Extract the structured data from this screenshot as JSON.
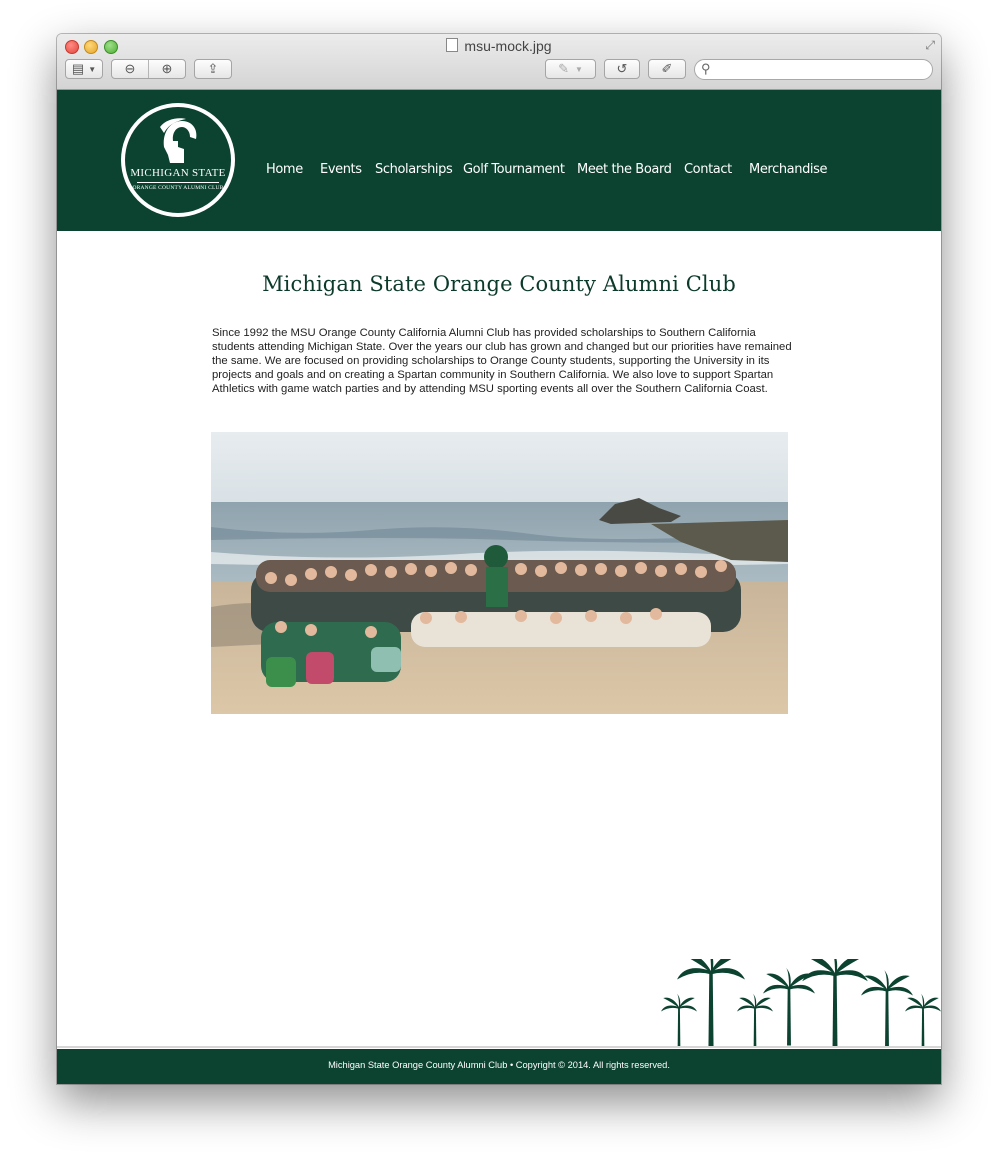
{
  "window": {
    "title": "msu-mock.jpg",
    "search_placeholder": ""
  },
  "site": {
    "logo": {
      "line1": "MICHIGAN STATE",
      "line2": "ORANGE COUNTY ALUMNI CLUB"
    },
    "nav": [
      "Home",
      "Events",
      "Scholarships",
      "Golf Tournament",
      "Meet the Board",
      "Contact",
      "Merchandise"
    ],
    "title": "Michigan State Orange County Alumni Club",
    "intro": "Since 1992 the MSU Orange County California Alumni Club has provided scholarships to Southern California students attending Michigan State.  Over the years our club has grown and changed but our priorities have remained the same.  We are focused on providing scholarships to Orange County students, supporting the University in its projects and goals and on creating a Spartan community in Southern California.  We also love to support Spartan Athletics with game watch parties and by attending MSU sporting events all over the Southern California Coast.",
    "footer": "Michigan State Orange County Alumni Club • Copyright © 2014. All rights reserved."
  },
  "colors": {
    "brand_green": "#0c4230",
    "title_green": "#0c3a2a"
  },
  "icons": {
    "toolbar": [
      "sidebar-icon",
      "zoom-out-icon",
      "zoom-in-icon",
      "share-icon",
      "annotate-icon",
      "rotate-icon",
      "edit-icon",
      "search-icon"
    ]
  }
}
